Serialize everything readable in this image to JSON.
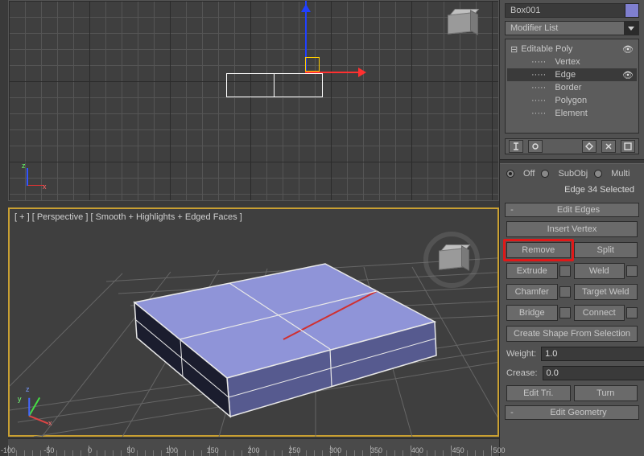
{
  "object_name": "Box001",
  "object_color": "#7f7fcf",
  "modifier_dropdown": "Modifier List",
  "stack": {
    "root": "Editable Poly",
    "sub": [
      "Vertex",
      "Edge",
      "Border",
      "Polygon",
      "Element"
    ],
    "selected": "Edge"
  },
  "selection_mode": {
    "off": "Off",
    "subobj": "SubObj",
    "multi": "Multi"
  },
  "status": "Edge 34 Selected",
  "rollouts": {
    "edit_edges": "Edit Edges",
    "edit_geometry": "Edit Geometry"
  },
  "buttons": {
    "insert_vertex": "Insert Vertex",
    "remove": "Remove",
    "split": "Split",
    "extrude": "Extrude",
    "weld": "Weld",
    "chamfer": "Chamfer",
    "target_weld": "Target Weld",
    "bridge": "Bridge",
    "connect": "Connect",
    "create_shape": "Create Shape From Selection",
    "edit_tri": "Edit Tri.",
    "turn": "Turn"
  },
  "spinners": {
    "weight": {
      "label": "Weight:",
      "value": "1.0"
    },
    "crease": {
      "label": "Crease:",
      "value": "0.0"
    }
  },
  "viewport": {
    "persp_label": "[ + ] [ Perspective ] [ Smooth + Highlights + Edged Faces ]",
    "axes": {
      "x": "x",
      "y": "y",
      "z": "z"
    }
  },
  "ruler": {
    "start": -100,
    "end": 500,
    "step": 50
  }
}
